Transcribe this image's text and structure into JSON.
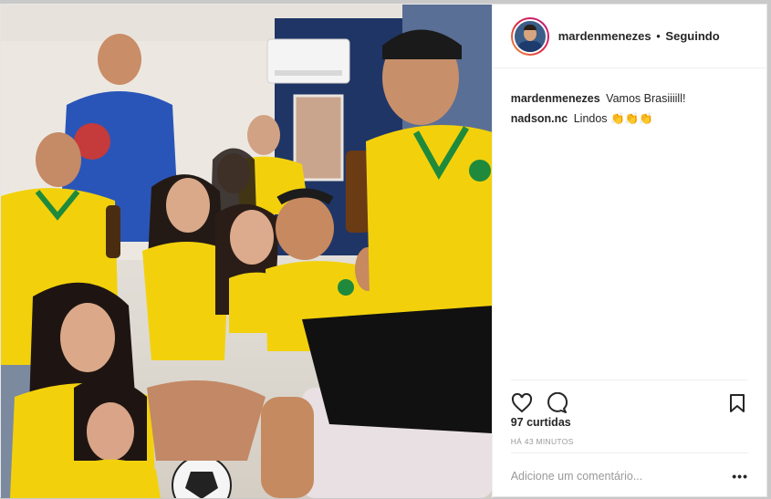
{
  "post": {
    "username": "mardenmenezes",
    "separator": "•",
    "follow_status": "Seguindo"
  },
  "comments": [
    {
      "user": "mardenmenezes",
      "text": "Vamos Brasiiiill!"
    },
    {
      "user": "nadson.nc",
      "text": "Lindos 👏👏👏"
    }
  ],
  "actions": {
    "like_icon": "heart-icon",
    "comment_icon": "comment-bubble-icon",
    "save_icon": "bookmark-icon"
  },
  "likes_text": "97 curtidas",
  "timestamp": "HÁ 43 MINUTOS",
  "add_comment": {
    "placeholder": "Adicione um comentário...",
    "more_label": "•••"
  },
  "colors": {
    "jersey_yellow": "#f2d10c",
    "jersey_green": "#1f8a3c",
    "jersey_blue": "#2a55b8",
    "wall_navy": "#1f3566"
  }
}
